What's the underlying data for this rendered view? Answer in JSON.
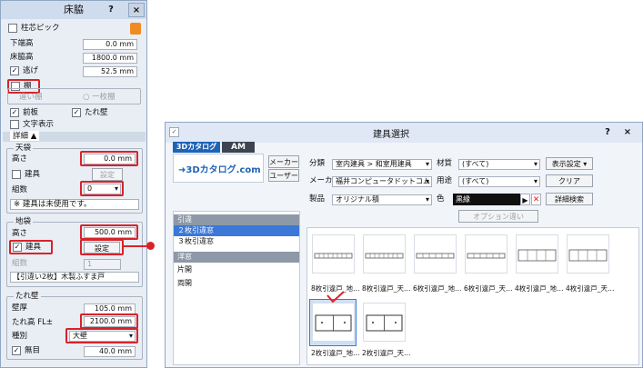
{
  "left_panel": {
    "title": "床脇",
    "help_btn": "?",
    "close_btn": "×",
    "pillar_check_label": "柱芯ピック",
    "floor_offset_label": "下端高",
    "floor_offset_value": "0.0 mm",
    "floor_height_label": "床脇高",
    "floor_height_value": "1800.0 mm",
    "escape_label": "逃げ",
    "escape_value": "52.5 mm",
    "shelf_label": "棚",
    "shelf_option1": "違い棚",
    "shelf_option2": "一枚棚",
    "front_board_label": "前板",
    "hanging_wall_label": "たれ壁",
    "text_display_label": "文字表示",
    "detail_label": "詳細",
    "upper_group": "天袋",
    "upper_height_label": "高さ",
    "upper_height_value": "0.0 mm",
    "upper_fitting_label": "建具",
    "upper_setting_btn": "設定",
    "upper_count_label": "組数",
    "upper_count_value": "0",
    "upper_note": "※ 建具は未使用です。",
    "lower_group": "地袋",
    "lower_height_label": "高さ",
    "lower_height_value": "500.0 mm",
    "lower_fitting_label": "建具",
    "lower_setting_btn": "設定",
    "lower_count_label": "組数",
    "lower_count_value": "1",
    "lower_info": "【引違い2枚】木製ふすま戸",
    "wall_group": "たれ壁",
    "wall_thickness_label": "壁厚",
    "wall_thickness_value": "105.0 mm",
    "wall_height_label": "たれ高 FL±",
    "wall_height_value": "2100.0 mm",
    "wall_type_label": "種別",
    "wall_type_value": "大壁",
    "mu_label": "無目",
    "mu_value": "40.0 mm"
  },
  "dialog": {
    "title": "建具選択",
    "help_btn": "?",
    "close_btn": "×",
    "tab_catalog": "3Dカタログ",
    "tab_am": "AM",
    "logo_text": "3Dカタログ.com",
    "maker_btn": "メーカー",
    "user_btn": "ユーザー",
    "bunrui_label": "分類",
    "bunrui_value": "室内建具 > 和室用建具",
    "zaishitsu_label": "材質",
    "zaishitsu_value": "(すべて)",
    "display_setting_btn": "表示設定",
    "maker_label": "メーカー",
    "maker_value": "福井コンピュータドットコム",
    "youto_label": "用途",
    "youto_value": "(すべて)",
    "clear_btn": "クリア",
    "seihin_label": "製品",
    "seihin_value": "オリジナル積",
    "iro_label": "色",
    "iro_value": "黒縁",
    "detail_search_btn": "詳細検索",
    "option_btn": "オプション違い",
    "categories": [
      {
        "label": "引違",
        "type": "header"
      },
      {
        "label": "２枚引違窓",
        "type": "selected"
      },
      {
        "label": "３枚引違窓",
        "type": "item"
      },
      {
        "label": "洋窓",
        "type": "header"
      },
      {
        "label": "片開",
        "type": "item"
      },
      {
        "label": "両開",
        "type": "item"
      }
    ],
    "thumbnails_row1": [
      {
        "caption": "8枚引違戸_地…"
      },
      {
        "caption": "8枚引違戸_天…"
      },
      {
        "caption": "6枚引違戸_地…"
      },
      {
        "caption": "6枚引違戸_天…"
      },
      {
        "caption": "4枚引違戸_地…"
      },
      {
        "caption": "4枚引違戸_天…"
      }
    ],
    "thumbnails_row2": [
      {
        "caption": "2枚引違戸_地…"
      },
      {
        "caption": "2枚引違戸_天…"
      }
    ]
  },
  "colors": {
    "accent_red": "#d8232a",
    "selection_blue": "#3b78d8",
    "category_header": "#8d99a8"
  }
}
